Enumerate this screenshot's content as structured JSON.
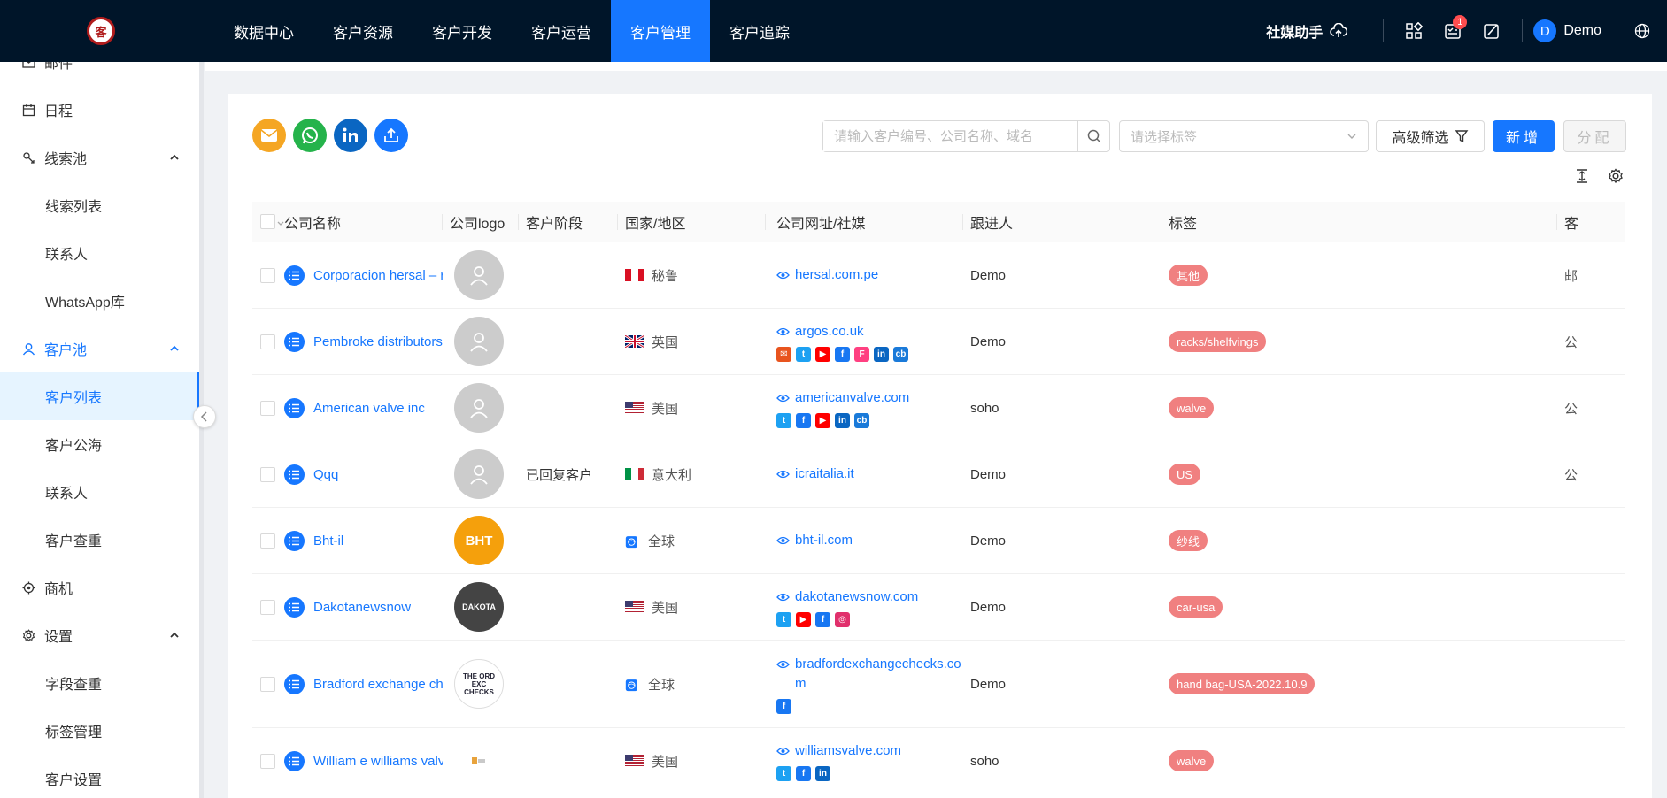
{
  "topbar": {
    "logo_text": "客",
    "nav": [
      "数据中心",
      "客户资源",
      "客户开发",
      "客户运营",
      "客户管理",
      "客户追踪"
    ],
    "active_nav_index": 4,
    "social_helper": "社媒助手",
    "badge_count": "1",
    "avatar_letter": "D",
    "user_name": "Demo"
  },
  "sidebar": {
    "items": [
      {
        "label": "邮件",
        "icon": "mail-icon",
        "type": "top"
      },
      {
        "label": "日程",
        "icon": "calendar-icon",
        "type": "top"
      },
      {
        "label": "线索池",
        "icon": "clue-icon",
        "type": "group"
      },
      {
        "label": "线索列表",
        "type": "sub"
      },
      {
        "label": "联系人",
        "type": "sub"
      },
      {
        "label": "WhatsApp库",
        "type": "sub"
      },
      {
        "label": "客户池",
        "icon": "user-icon",
        "type": "group",
        "active": true
      },
      {
        "label": "客户列表",
        "type": "sub",
        "active": true
      },
      {
        "label": "客户公海",
        "type": "sub"
      },
      {
        "label": "联系人",
        "type": "sub"
      },
      {
        "label": "客户查重",
        "type": "sub"
      },
      {
        "label": "商机",
        "icon": "target-icon",
        "type": "top"
      },
      {
        "label": "设置",
        "icon": "gear-icon",
        "type": "group"
      },
      {
        "label": "字段查重",
        "type": "sub"
      },
      {
        "label": "标签管理",
        "type": "sub"
      },
      {
        "label": "客户设置",
        "type": "sub"
      }
    ]
  },
  "toolbar": {
    "search_placeholder": "请输入客户编号、公司名称、域名",
    "tag_placeholder": "请选择标签",
    "advanced_filter": "高级筛选",
    "add_label": "新增",
    "assign_label": "分配"
  },
  "table": {
    "columns": [
      "公司名称",
      "公司logo",
      "客户阶段",
      "国家/地区",
      "公司网址/社媒",
      "跟进人",
      "标签",
      "客"
    ],
    "rows": [
      {
        "name": "Corporacion hersal – r...",
        "stage": "",
        "flag": "pe",
        "country": "秘鲁",
        "website": "hersal.com.pe",
        "socials": [],
        "owner": "Demo",
        "tag": "其他",
        "more": "邮",
        "logo": "placeholder"
      },
      {
        "name": "Pembroke distributors...",
        "stage": "",
        "flag": "uk",
        "country": "英国",
        "website": "argos.co.uk",
        "socials": [
          "mail",
          "twitter",
          "youtube",
          "facebook",
          "flickr",
          "linkedin",
          "crunchbase"
        ],
        "owner": "Demo",
        "tag": "racks/shelfvings",
        "more": "公",
        "logo": "placeholder"
      },
      {
        "name": "American valve inc",
        "stage": "",
        "flag": "us",
        "country": "美国",
        "website": "americanvalve.com",
        "socials": [
          "twitter",
          "facebook",
          "youtube",
          "linkedin",
          "crunchbase"
        ],
        "owner": "soho",
        "tag": "walve",
        "more": "公",
        "logo": "placeholder"
      },
      {
        "name": "Qqq",
        "stage": "已回复客户",
        "flag": "it",
        "country": "意大利",
        "website": "icraitalia.it",
        "socials": [],
        "owner": "Demo",
        "tag": "US",
        "more": "公",
        "logo": "placeholder"
      },
      {
        "name": "Bht-il",
        "stage": "",
        "flag": "globe",
        "country": "全球",
        "website": "bht-il.com",
        "socials": [],
        "owner": "Demo",
        "tag": "纱线",
        "more": "",
        "logo": "bht"
      },
      {
        "name": "Dakotanewsnow",
        "stage": "",
        "flag": "us",
        "country": "美国",
        "website": "dakotanewsnow.com",
        "socials": [
          "twitter",
          "youtube",
          "facebook",
          "instagram"
        ],
        "owner": "Demo",
        "tag": "car-usa",
        "more": "",
        "logo": "dakota"
      },
      {
        "name": "Bradford exchange ch...",
        "stage": "",
        "flag": "globe",
        "country": "全球",
        "website": "bradfordexchangechecks.com",
        "socials": [
          "facebook"
        ],
        "owner": "Demo",
        "tag": "hand bag-USA-2022.10.9",
        "more": "",
        "logo": "bradford"
      },
      {
        "name": "William e williams valv...",
        "stage": "",
        "flag": "us",
        "country": "美国",
        "website": "williamsvalve.com",
        "socials": [
          "twitter",
          "facebook",
          "linkedin"
        ],
        "owner": "soho",
        "tag": "walve",
        "more": "",
        "logo": "williams"
      }
    ],
    "row_heights": [
      75,
      75,
      75,
      75,
      75,
      75,
      99,
      75
    ]
  },
  "logo_texts": {
    "bht": "BHT",
    "dakota": "DAKOTA",
    "bradford": "THE ORD EXC CHECKS"
  },
  "colors": {
    "nav_bg": "#001529",
    "accent": "#1677ff",
    "tag": "#f08080",
    "email_icon": "#f5a623",
    "whatsapp_icon": "#25b34b",
    "linkedin_icon": "#0a66c2",
    "upload_icon": "#1677ff"
  }
}
